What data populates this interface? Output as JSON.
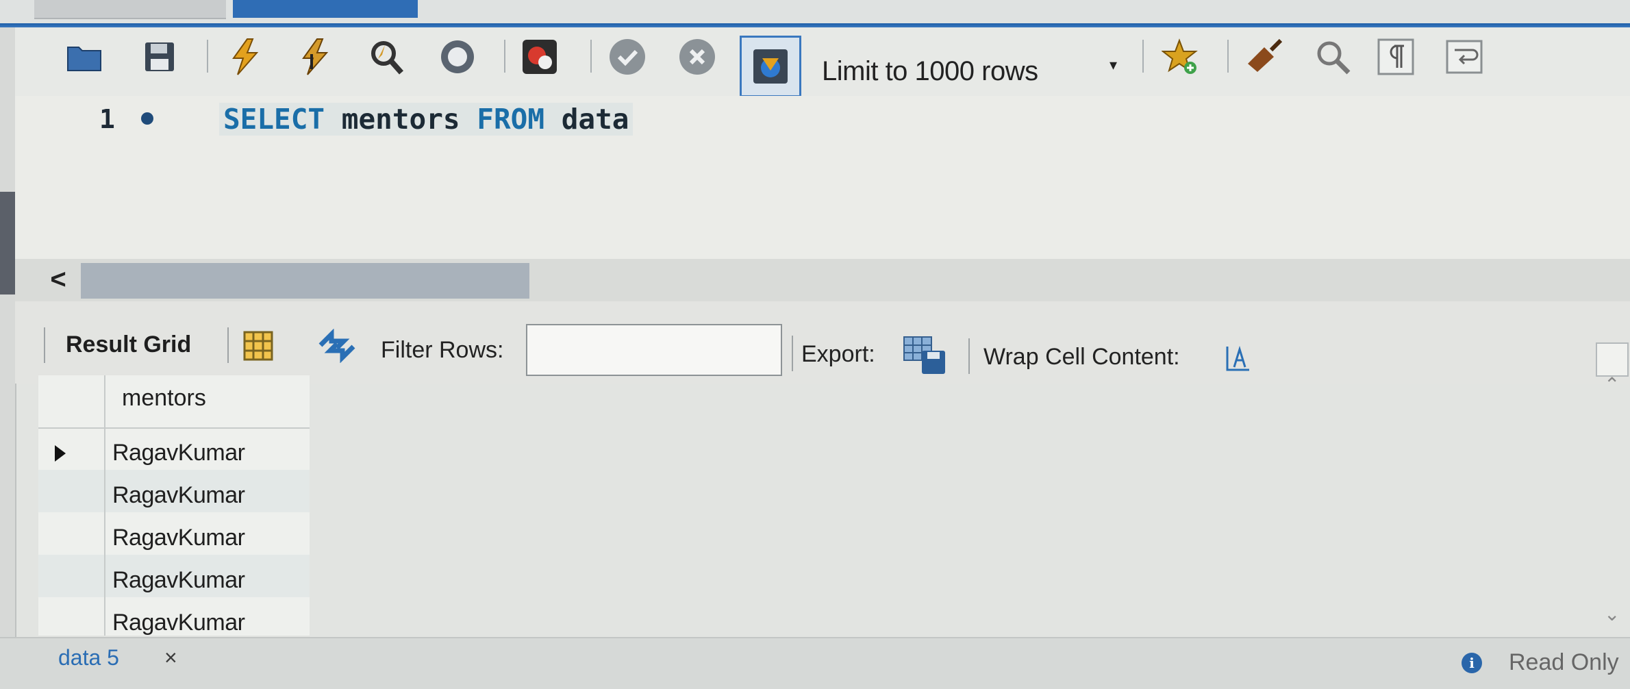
{
  "colors": {
    "accent": "#2f6db5",
    "sql_keyword": "#1a6ea8",
    "tab_text": "#2a6db4",
    "thumb": "#a9b2bb"
  },
  "toolbar": {
    "icons": [
      "open-folder-icon",
      "save-icon",
      "execute-lightning-icon",
      "execute-cursor-lightning-icon",
      "explain-magnifier-icon",
      "stop-icon",
      "toggle-error-icon",
      "commit-check-icon",
      "rollback-x-icon",
      "autocommit-toggle-icon"
    ],
    "limit_label": "Limit to 1000 rows",
    "right_icons": [
      "add-snippet-star-icon",
      "beautify-broom-icon",
      "find-icon",
      "invisible-chars-icon",
      "word-wrap-icon"
    ]
  },
  "editor": {
    "line_number": "1",
    "sql": {
      "kw_select": "SELECT",
      "col": "mentors",
      "kw_from": "FROM",
      "table": "data"
    }
  },
  "result_toolbar": {
    "result_grid_label": "Result Grid",
    "filter_label": "Filter Rows:",
    "filter_value": "",
    "export_label": "Export:",
    "wrap_label": "Wrap Cell Content:"
  },
  "grid": {
    "columns": [
      "mentors"
    ],
    "rows": [
      {
        "mentors": "RagavKumar"
      },
      {
        "mentors": "RagavKumar"
      },
      {
        "mentors": "RagavKumar"
      },
      {
        "mentors": "RagavKumar"
      },
      {
        "mentors": "RagavKumar"
      }
    ]
  },
  "bottom": {
    "tab_label": "data 5",
    "close_glyph": "×",
    "status": "Read Only"
  },
  "hscroll": {
    "left_arrow": "<"
  }
}
